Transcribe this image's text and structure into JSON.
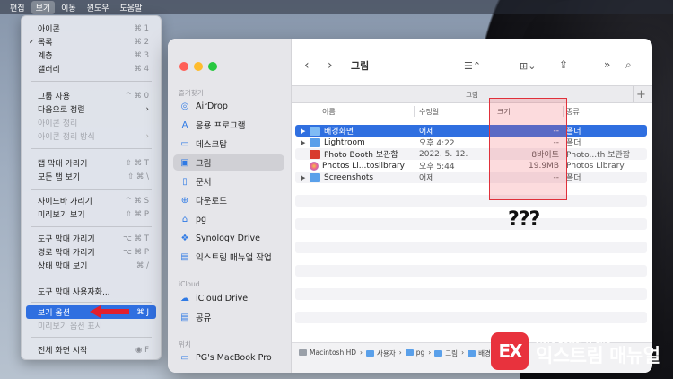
{
  "menubar": {
    "items": [
      "편집",
      "보기",
      "이동",
      "윈도우",
      "도움말"
    ],
    "active_index": 1
  },
  "view_menu": {
    "items": [
      {
        "label": "아이콘",
        "shortcut": "⌘ 1"
      },
      {
        "label": "목록",
        "shortcut": "⌘ 2",
        "checked": true
      },
      {
        "label": "계층",
        "shortcut": "⌘ 3"
      },
      {
        "label": "갤러리",
        "shortcut": "⌘ 4"
      },
      {
        "label": "그룹 사용",
        "shortcut": "^ ⌘ 0"
      },
      {
        "label": "다음으로 정렬",
        "submenu": true
      },
      {
        "label": "아이콘 정리",
        "disabled": true
      },
      {
        "label": "아이콘 정리 방식",
        "disabled": true,
        "submenu": true
      },
      {
        "label": "탭 막대 가리기",
        "shortcut": "⇧ ⌘ T"
      },
      {
        "label": "모든 탭 보기",
        "shortcut": "⇧ ⌘ \\"
      },
      {
        "label": "사이드바 가리기",
        "shortcut": "^ ⌘ S"
      },
      {
        "label": "미리보기 보기",
        "shortcut": "⇧ ⌘ P"
      },
      {
        "label": "도구 막대 가리기",
        "shortcut": "⌥ ⌘ T"
      },
      {
        "label": "경로 막대 가리기",
        "shortcut": "⌥ ⌘ P"
      },
      {
        "label": "상태 막대 보기",
        "shortcut": "⌘ /"
      },
      {
        "label": "도구 막대 사용자화..."
      },
      {
        "label": "보기 옵션",
        "shortcut": "⌘ J",
        "selected": true
      },
      {
        "label": "미리보기 옵션 표시",
        "disabled": true
      },
      {
        "label": "전체 화면 시작",
        "shortcut": "◉ F"
      }
    ]
  },
  "finder": {
    "title": "그림",
    "tab_label": "그림",
    "sidebar": {
      "favorites_header": "즐겨찾기",
      "favorites": [
        {
          "label": "AirDrop",
          "icon": "airdrop-icon"
        },
        {
          "label": "응용 프로그램",
          "icon": "applications-icon"
        },
        {
          "label": "데스크탑",
          "icon": "desktop-icon"
        },
        {
          "label": "그림",
          "icon": "pictures-icon",
          "selected": true
        },
        {
          "label": "문서",
          "icon": "document-icon"
        },
        {
          "label": "다운로드",
          "icon": "download-icon"
        },
        {
          "label": "pg",
          "icon": "home-icon"
        },
        {
          "label": "Synology Drive",
          "icon": "synology-icon"
        },
        {
          "label": "익스트림 매뉴얼 작업",
          "icon": "folder-icon"
        }
      ],
      "icloud_header": "iCloud",
      "icloud": [
        {
          "label": "iCloud Drive",
          "icon": "cloud-icon"
        },
        {
          "label": "공유",
          "icon": "shared-folder-icon"
        }
      ],
      "locations_header": "위치",
      "locations": [
        {
          "label": "PG's MacBook Pro",
          "icon": "laptop-icon"
        }
      ]
    },
    "columns": {
      "name": "이름",
      "modified": "수정일",
      "size": "크기",
      "kind": "종류"
    },
    "files": [
      {
        "name": "배경화면",
        "modified": "어제",
        "size": "--",
        "kind": "폴더",
        "type": "folder",
        "expandable": true,
        "selected": true
      },
      {
        "name": "Lightroom",
        "modified": "오후 4:22",
        "size": "--",
        "kind": "폴더",
        "type": "folder",
        "expandable": true
      },
      {
        "name": "Photo Booth 보관함",
        "modified": "2022. 5. 12.",
        "size": "8바이트",
        "kind": "Photo...th 보관함",
        "type": "photobooth"
      },
      {
        "name": "Photos Li...toslibrary",
        "modified": "오후 5:44",
        "size": "19.9MB",
        "kind": "Photos Library",
        "type": "photos"
      },
      {
        "name": "Screenshots",
        "modified": "어제",
        "size": "--",
        "kind": "폴더",
        "type": "folder",
        "expandable": true
      }
    ],
    "path": [
      "Macintosh HD",
      "사용자",
      "pg",
      "그림",
      "배경화면"
    ]
  },
  "annotation": {
    "question_marks": "???"
  },
  "watermark": {
    "badge": "EX",
    "tagline": "More Better IT Life",
    "brand": "익스트림 매뉴얼"
  },
  "colors": {
    "accent": "#2f6fe0",
    "highlight_box": "#e0303a",
    "brand_red": "#e8323d"
  }
}
